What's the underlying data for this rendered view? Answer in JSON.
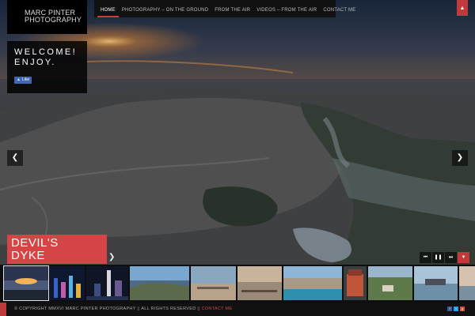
{
  "brand": {
    "line1": "MARC PINTER",
    "line2": "PHOTOGRAPHY"
  },
  "nav": {
    "items": [
      {
        "label": "HOME",
        "active": true
      },
      {
        "label": "PHOTOGRAPHY – ON THE GROUND",
        "active": false
      },
      {
        "label": "FROM THE AIR",
        "active": false
      },
      {
        "label": "VIDEOS – FROM THE AIR",
        "active": false
      },
      {
        "label": "CONTACT ME",
        "active": false
      }
    ]
  },
  "welcome": {
    "line1": "WELCOME!",
    "line2": "ENJOY.",
    "like_label": "Like"
  },
  "slide": {
    "title_line1": "DEVIL'S",
    "title_line2": "DYKE"
  },
  "controls": {
    "prev_icon": "chevron-left-icon",
    "next_icon": "chevron-right-icon",
    "play_prev_icon": "skip-back-icon",
    "pause_icon": "pause-icon",
    "play_next_icon": "skip-forward-icon",
    "collapse_icon": "chevron-down-icon",
    "top_toggle_icon": "chevron-up-icon"
  },
  "thumbnails": [
    {
      "name": "sunset-coast",
      "active": true
    },
    {
      "name": "city-night-1",
      "active": false
    },
    {
      "name": "city-night-2",
      "active": false
    },
    {
      "name": "coast-cliffs",
      "active": false
    },
    {
      "name": "pier-town",
      "active": false
    },
    {
      "name": "pier-sea",
      "active": false
    },
    {
      "name": "seafront-aerial",
      "active": false
    },
    {
      "name": "red-building",
      "active": false
    },
    {
      "name": "green-fields",
      "active": false
    },
    {
      "name": "harbour-ship",
      "active": false
    },
    {
      "name": "sky-partial",
      "active": false
    }
  ],
  "footer": {
    "copyright": "© COPYRIGHT MMXVI MARC PINTER PHOTOGRAPHY ▯ ALL RIGHTS RESERVED ▯",
    "contact_label": "CONTACT ME"
  },
  "colors": {
    "accent": "#d64545",
    "dark": "#111111"
  }
}
